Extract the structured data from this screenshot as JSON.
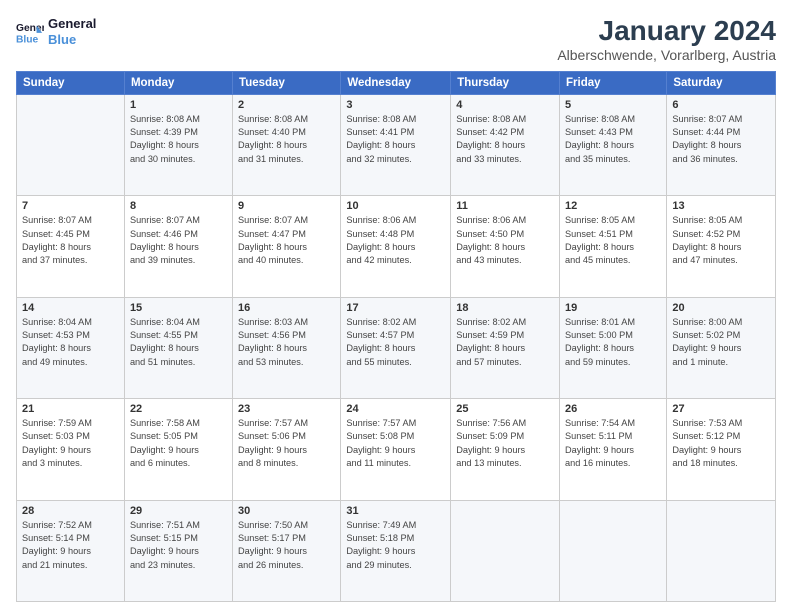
{
  "logo": {
    "line1": "General",
    "line2": "Blue"
  },
  "title": "January 2024",
  "subtitle": "Alberschwende, Vorarlberg, Austria",
  "headers": [
    "Sunday",
    "Monday",
    "Tuesday",
    "Wednesday",
    "Thursday",
    "Friday",
    "Saturday"
  ],
  "weeks": [
    [
      {
        "day": "",
        "sunrise": "",
        "sunset": "",
        "daylight": ""
      },
      {
        "day": "1",
        "sunrise": "Sunrise: 8:08 AM",
        "sunset": "Sunset: 4:39 PM",
        "daylight": "Daylight: 8 hours and 30 minutes."
      },
      {
        "day": "2",
        "sunrise": "Sunrise: 8:08 AM",
        "sunset": "Sunset: 4:40 PM",
        "daylight": "Daylight: 8 hours and 31 minutes."
      },
      {
        "day": "3",
        "sunrise": "Sunrise: 8:08 AM",
        "sunset": "Sunset: 4:41 PM",
        "daylight": "Daylight: 8 hours and 32 minutes."
      },
      {
        "day": "4",
        "sunrise": "Sunrise: 8:08 AM",
        "sunset": "Sunset: 4:42 PM",
        "daylight": "Daylight: 8 hours and 33 minutes."
      },
      {
        "day": "5",
        "sunrise": "Sunrise: 8:08 AM",
        "sunset": "Sunset: 4:43 PM",
        "daylight": "Daylight: 8 hours and 35 minutes."
      },
      {
        "day": "6",
        "sunrise": "Sunrise: 8:07 AM",
        "sunset": "Sunset: 4:44 PM",
        "daylight": "Daylight: 8 hours and 36 minutes."
      }
    ],
    [
      {
        "day": "7",
        "sunrise": "Sunrise: 8:07 AM",
        "sunset": "Sunset: 4:45 PM",
        "daylight": "Daylight: 8 hours and 37 minutes."
      },
      {
        "day": "8",
        "sunrise": "Sunrise: 8:07 AM",
        "sunset": "Sunset: 4:46 PM",
        "daylight": "Daylight: 8 hours and 39 minutes."
      },
      {
        "day": "9",
        "sunrise": "Sunrise: 8:07 AM",
        "sunset": "Sunset: 4:47 PM",
        "daylight": "Daylight: 8 hours and 40 minutes."
      },
      {
        "day": "10",
        "sunrise": "Sunrise: 8:06 AM",
        "sunset": "Sunset: 4:48 PM",
        "daylight": "Daylight: 8 hours and 42 minutes."
      },
      {
        "day": "11",
        "sunrise": "Sunrise: 8:06 AM",
        "sunset": "Sunset: 4:50 PM",
        "daylight": "Daylight: 8 hours and 43 minutes."
      },
      {
        "day": "12",
        "sunrise": "Sunrise: 8:05 AM",
        "sunset": "Sunset: 4:51 PM",
        "daylight": "Daylight: 8 hours and 45 minutes."
      },
      {
        "day": "13",
        "sunrise": "Sunrise: 8:05 AM",
        "sunset": "Sunset: 4:52 PM",
        "daylight": "Daylight: 8 hours and 47 minutes."
      }
    ],
    [
      {
        "day": "14",
        "sunrise": "Sunrise: 8:04 AM",
        "sunset": "Sunset: 4:53 PM",
        "daylight": "Daylight: 8 hours and 49 minutes."
      },
      {
        "day": "15",
        "sunrise": "Sunrise: 8:04 AM",
        "sunset": "Sunset: 4:55 PM",
        "daylight": "Daylight: 8 hours and 51 minutes."
      },
      {
        "day": "16",
        "sunrise": "Sunrise: 8:03 AM",
        "sunset": "Sunset: 4:56 PM",
        "daylight": "Daylight: 8 hours and 53 minutes."
      },
      {
        "day": "17",
        "sunrise": "Sunrise: 8:02 AM",
        "sunset": "Sunset: 4:57 PM",
        "daylight": "Daylight: 8 hours and 55 minutes."
      },
      {
        "day": "18",
        "sunrise": "Sunrise: 8:02 AM",
        "sunset": "Sunset: 4:59 PM",
        "daylight": "Daylight: 8 hours and 57 minutes."
      },
      {
        "day": "19",
        "sunrise": "Sunrise: 8:01 AM",
        "sunset": "Sunset: 5:00 PM",
        "daylight": "Daylight: 8 hours and 59 minutes."
      },
      {
        "day": "20",
        "sunrise": "Sunrise: 8:00 AM",
        "sunset": "Sunset: 5:02 PM",
        "daylight": "Daylight: 9 hours and 1 minute."
      }
    ],
    [
      {
        "day": "21",
        "sunrise": "Sunrise: 7:59 AM",
        "sunset": "Sunset: 5:03 PM",
        "daylight": "Daylight: 9 hours and 3 minutes."
      },
      {
        "day": "22",
        "sunrise": "Sunrise: 7:58 AM",
        "sunset": "Sunset: 5:05 PM",
        "daylight": "Daylight: 9 hours and 6 minutes."
      },
      {
        "day": "23",
        "sunrise": "Sunrise: 7:57 AM",
        "sunset": "Sunset: 5:06 PM",
        "daylight": "Daylight: 9 hours and 8 minutes."
      },
      {
        "day": "24",
        "sunrise": "Sunrise: 7:57 AM",
        "sunset": "Sunset: 5:08 PM",
        "daylight": "Daylight: 9 hours and 11 minutes."
      },
      {
        "day": "25",
        "sunrise": "Sunrise: 7:56 AM",
        "sunset": "Sunset: 5:09 PM",
        "daylight": "Daylight: 9 hours and 13 minutes."
      },
      {
        "day": "26",
        "sunrise": "Sunrise: 7:54 AM",
        "sunset": "Sunset: 5:11 PM",
        "daylight": "Daylight: 9 hours and 16 minutes."
      },
      {
        "day": "27",
        "sunrise": "Sunrise: 7:53 AM",
        "sunset": "Sunset: 5:12 PM",
        "daylight": "Daylight: 9 hours and 18 minutes."
      }
    ],
    [
      {
        "day": "28",
        "sunrise": "Sunrise: 7:52 AM",
        "sunset": "Sunset: 5:14 PM",
        "daylight": "Daylight: 9 hours and 21 minutes."
      },
      {
        "day": "29",
        "sunrise": "Sunrise: 7:51 AM",
        "sunset": "Sunset: 5:15 PM",
        "daylight": "Daylight: 9 hours and 23 minutes."
      },
      {
        "day": "30",
        "sunrise": "Sunrise: 7:50 AM",
        "sunset": "Sunset: 5:17 PM",
        "daylight": "Daylight: 9 hours and 26 minutes."
      },
      {
        "day": "31",
        "sunrise": "Sunrise: 7:49 AM",
        "sunset": "Sunset: 5:18 PM",
        "daylight": "Daylight: 9 hours and 29 minutes."
      },
      {
        "day": "",
        "sunrise": "",
        "sunset": "",
        "daylight": ""
      },
      {
        "day": "",
        "sunrise": "",
        "sunset": "",
        "daylight": ""
      },
      {
        "day": "",
        "sunrise": "",
        "sunset": "",
        "daylight": ""
      }
    ]
  ]
}
